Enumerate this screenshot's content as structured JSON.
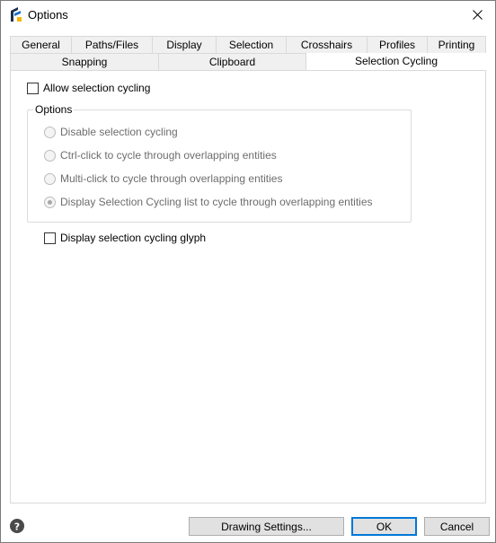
{
  "window": {
    "title": "Options"
  },
  "tabs": {
    "row1": [
      {
        "label": "General",
        "active": false
      },
      {
        "label": "Paths/Files",
        "active": false
      },
      {
        "label": "Display",
        "active": false
      },
      {
        "label": "Selection",
        "active": false
      },
      {
        "label": "Crosshairs",
        "active": false
      },
      {
        "label": "Profiles",
        "active": false
      },
      {
        "label": "Printing",
        "active": false
      }
    ],
    "row2": [
      {
        "label": "Snapping",
        "active": false
      },
      {
        "label": "Clipboard",
        "active": false
      },
      {
        "label": "Selection Cycling",
        "active": true
      }
    ]
  },
  "panel": {
    "allow_cycling": {
      "label": "Allow selection cycling",
      "checked": false
    },
    "options_group": {
      "legend": "Options",
      "radios": [
        {
          "label": "Disable selection cycling",
          "checked": false,
          "disabled": true
        },
        {
          "label": "Ctrl-click to cycle through overlapping entities",
          "checked": false,
          "disabled": true
        },
        {
          "label": "Multi-click to cycle through overlapping entities",
          "checked": false,
          "disabled": true
        },
        {
          "label": "Display Selection Cycling list to cycle through overlapping entities",
          "checked": true,
          "disabled": true
        }
      ]
    },
    "display_glyph": {
      "label": "Display selection cycling glyph",
      "checked": false
    }
  },
  "buttons": {
    "drawing_settings": "Drawing Settings...",
    "ok": "OK",
    "cancel": "Cancel"
  },
  "colors": {
    "accent": "#0078d7",
    "icon_blue": "#1a6fc8",
    "icon_dark": "#1b2f4a",
    "icon_yellow": "#f5b800"
  }
}
